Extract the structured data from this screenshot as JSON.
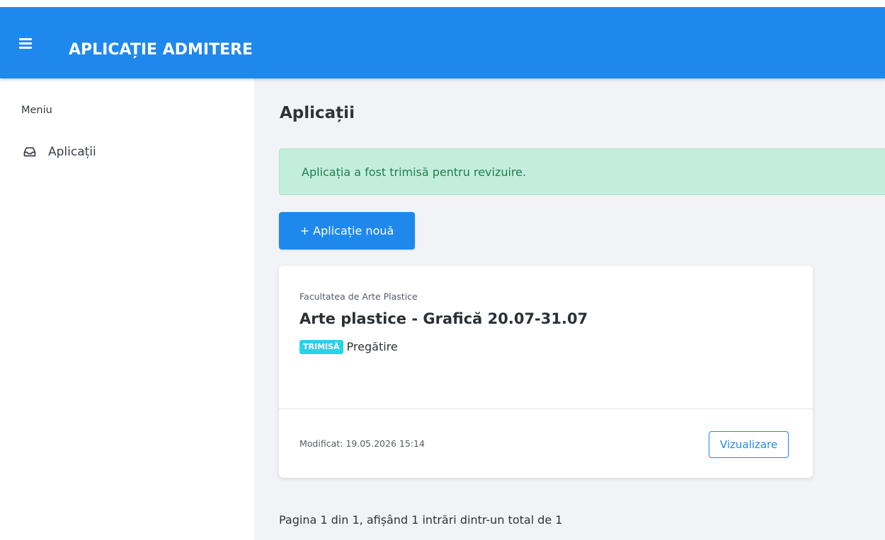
{
  "header": {
    "menu_icon": "hamburger-icon",
    "title": "APLICAȚIE ADMITERE",
    "brand_color": "#1e88ed"
  },
  "sidebar": {
    "header": "Meniu",
    "items": [
      {
        "label": "Aplicații",
        "icon": "inbox-icon",
        "active": false
      }
    ]
  },
  "main": {
    "title": "Aplicații",
    "alert": {
      "text": "Aplicația a fost trimisă pentru revizuire.",
      "type": "success",
      "color": "#1e7e4e"
    },
    "new_button": {
      "label": "+ Aplicație nouă"
    },
    "applications": [
      {
        "faculty": "Facultatea de Arte Plastice",
        "program": "Arte plastice - Grafică 20.07-31.07",
        "status_badge": "TRIMISĂ",
        "status_color": "#27d3e8",
        "stage": "Pregătire",
        "modified": "Modificat: 19.05.2026 15:14",
        "view_label": "Vizualizare"
      }
    ],
    "pagination": "Pagina 1 din 1, afișând 1 intrări dintr-un total de 1"
  }
}
